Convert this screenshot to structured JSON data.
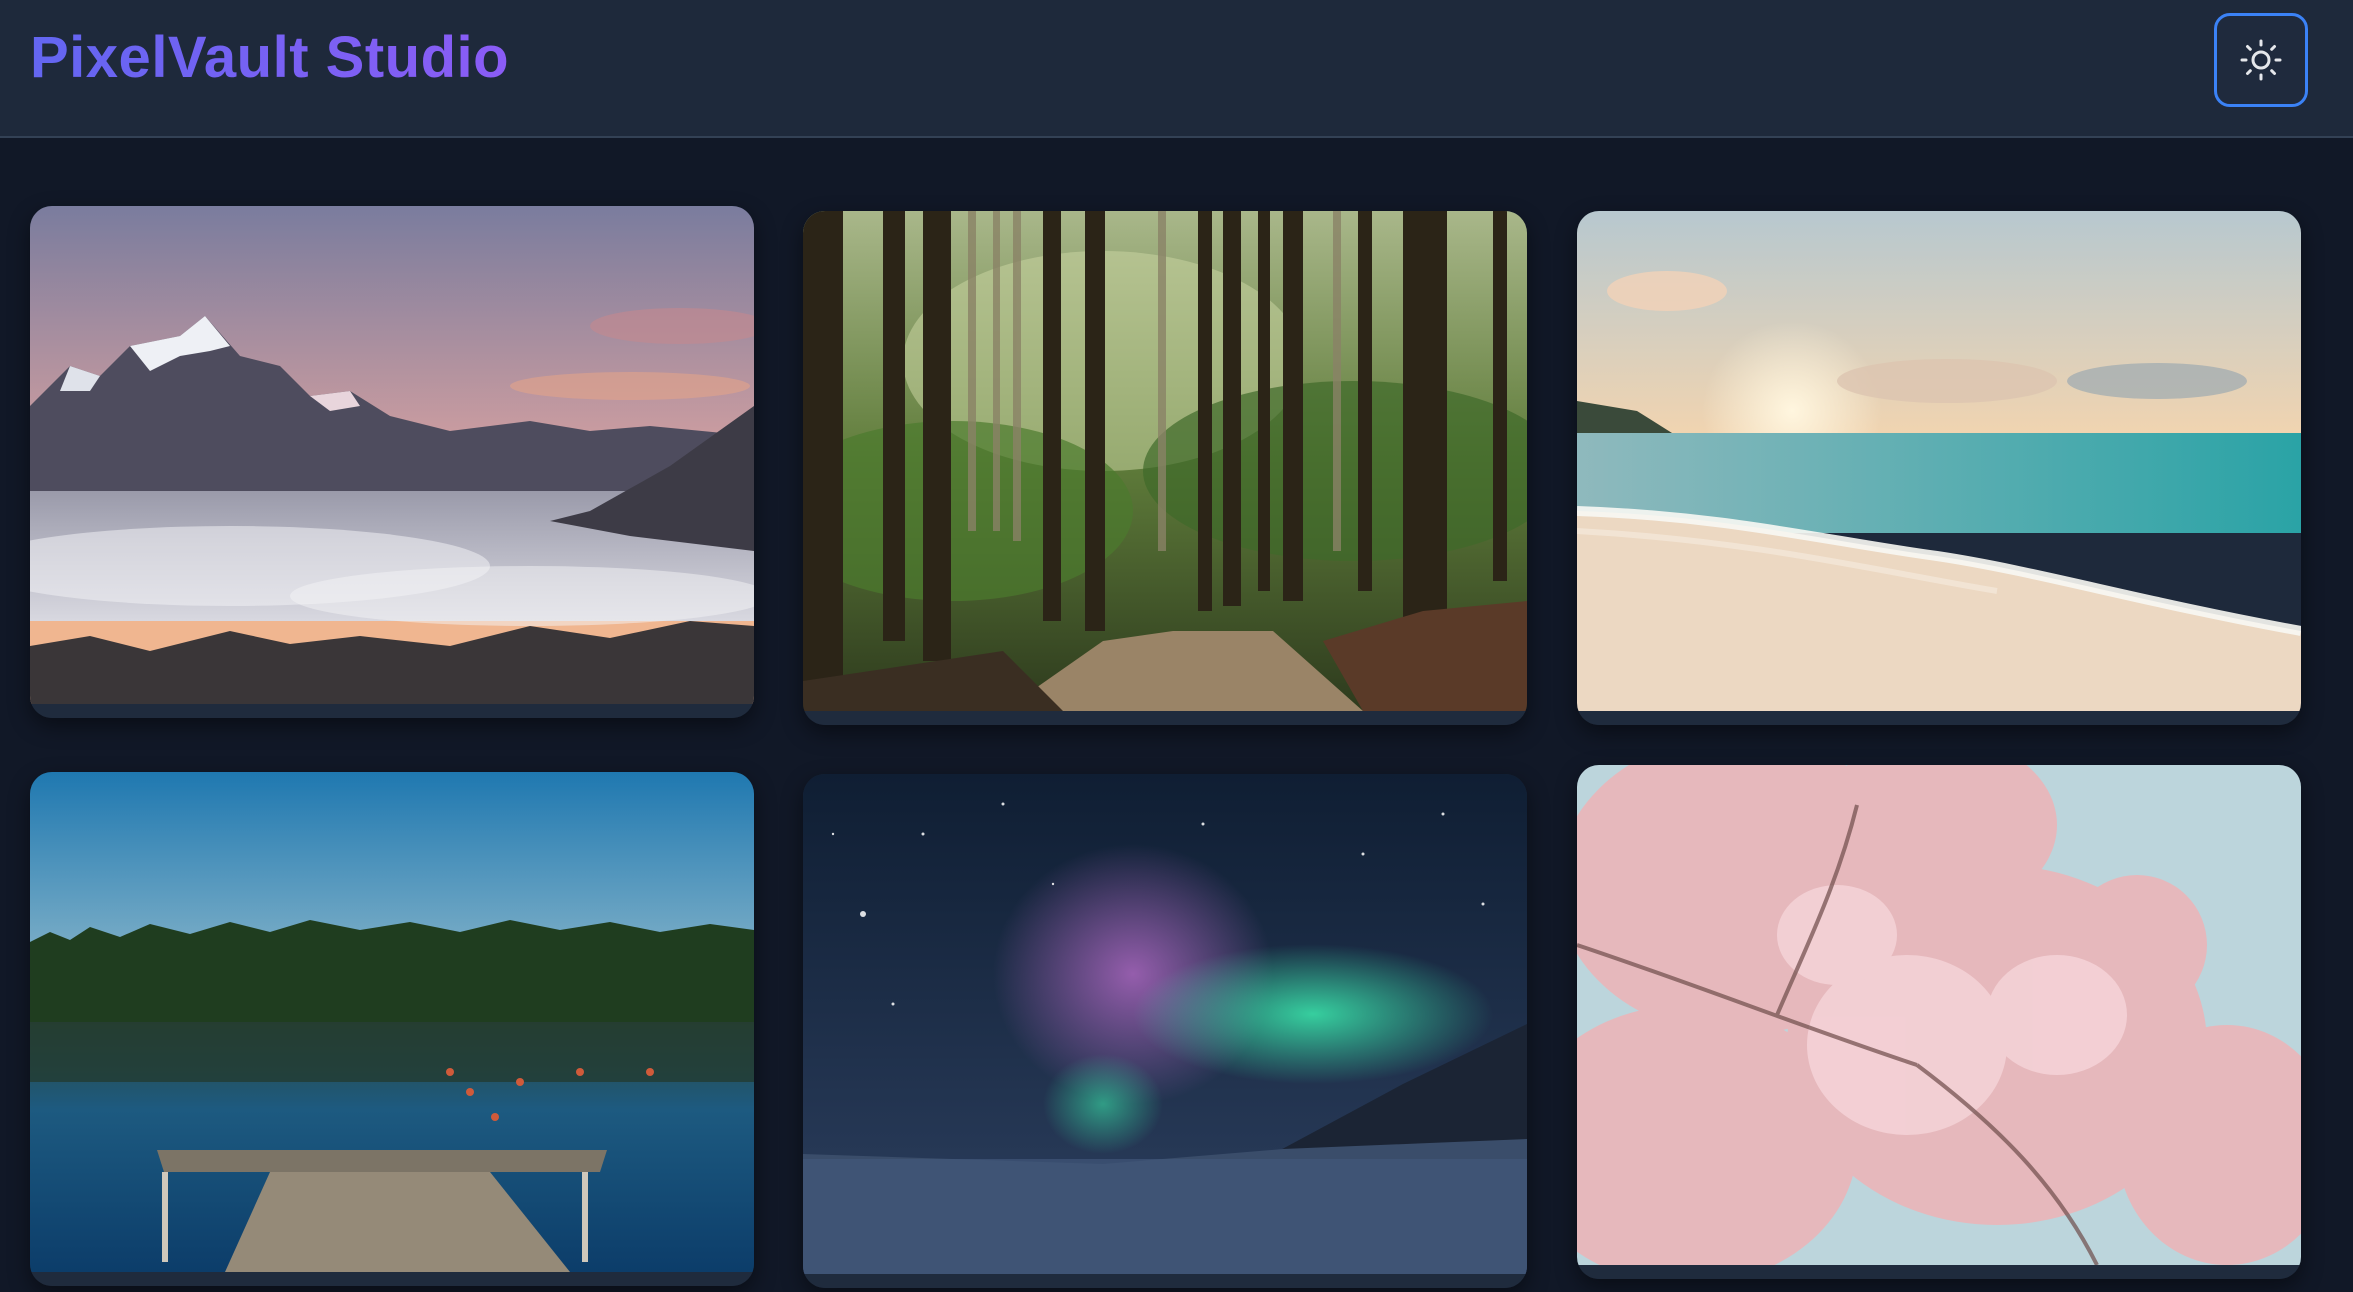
{
  "header": {
    "brand": "PixelVault Studio",
    "theme_toggle_icon": "sun-icon"
  },
  "gallery": {
    "items": [
      {
        "scene": "mountains-above-clouds",
        "icon": "image"
      },
      {
        "scene": "forest-path",
        "icon": "image"
      },
      {
        "scene": "beach-sunset",
        "icon": "image"
      },
      {
        "scene": "lake-dock",
        "icon": "image"
      },
      {
        "scene": "aurora-night",
        "icon": "image"
      },
      {
        "scene": "cherry-blossoms",
        "icon": "image"
      }
    ]
  },
  "colors": {
    "background": "#111827",
    "header": "#1e293b",
    "accent": "#3b82f6",
    "brand_gradient_start": "#6366f1",
    "brand_gradient_end": "#8b5cf6"
  }
}
